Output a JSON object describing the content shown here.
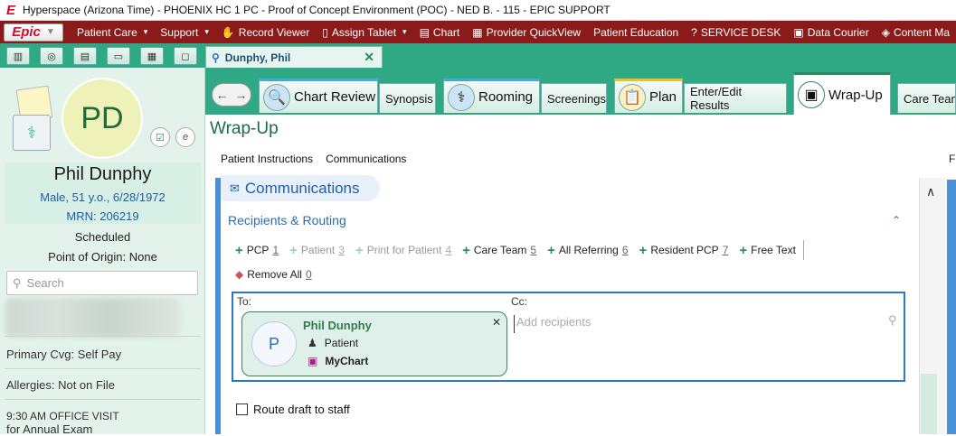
{
  "window": {
    "title": "Hyperspace (Arizona Time) - PHOENIX HC 1 PC - Proof of Concept Environment (POC) - NED B. - 115 - EPIC SUPPORT"
  },
  "menubar": {
    "epic_label": "Epic",
    "items": [
      {
        "label": "Patient Care",
        "icon": "none",
        "dropdown": true
      },
      {
        "label": "Support",
        "icon": "none",
        "dropdown": true
      },
      {
        "label": "Record Viewer",
        "icon": "hand-icon",
        "dropdown": false
      },
      {
        "label": "Assign Tablet",
        "icon": "tablet-icon",
        "dropdown": true
      },
      {
        "label": "Chart",
        "icon": "chart-icon",
        "dropdown": false
      },
      {
        "label": "Provider QuickView",
        "icon": "quickview-icon",
        "dropdown": false
      },
      {
        "label": "Patient Education",
        "icon": "none",
        "dropdown": false
      },
      {
        "label": "SERVICE DESK",
        "icon": "question-icon",
        "dropdown": false
      },
      {
        "label": "Data Courier",
        "icon": "courier-icon",
        "dropdown": false
      },
      {
        "label": "Content Ma",
        "icon": "diamond-icon",
        "dropdown": false
      }
    ]
  },
  "patient_tab": {
    "label": "Dunphy, Phil"
  },
  "sidebar": {
    "initials": "PD",
    "name": "Phil Dunphy",
    "demographics": "Male, 51 y.o., 6/28/1972",
    "mrn": "MRN: 206219",
    "status": "Scheduled",
    "point_of_origin": "Point of Origin: None",
    "search_placeholder": "Search",
    "coverage": "Primary Cvg: Self Pay",
    "allergies": "Allergies: Not on File",
    "visit_line1": "9:30 AM OFFICE VISIT",
    "visit_line2": "for Annual Exam"
  },
  "activity_tabs": [
    {
      "label": "Chart Review",
      "big": true
    },
    {
      "label": "Synopsis",
      "big": false
    },
    {
      "label": "Rooming",
      "big": true
    },
    {
      "label": "Screenings",
      "big": false
    },
    {
      "label": "Plan",
      "big": true
    },
    {
      "label": "Enter/Edit Results",
      "big": false
    },
    {
      "label": "Wrap-Up",
      "big": true,
      "active": true
    },
    {
      "label": "Care Team",
      "big": false
    }
  ],
  "content": {
    "title": "Wrap-Up",
    "subtabs": [
      "Patient Instructions",
      "Communications"
    ],
    "right_cut_letter": "F",
    "section_title": "Communications",
    "subsection_title": "Recipients & Routing",
    "routing_buttons": [
      {
        "label": "PCP",
        "count": "1",
        "enabled": true
      },
      {
        "label": "Patient",
        "count": "3",
        "enabled": false
      },
      {
        "label": "Print for Patient",
        "count": "4",
        "enabled": false
      },
      {
        "label": "Care Team",
        "count": "5",
        "enabled": true
      },
      {
        "label": "All Referring",
        "count": "6",
        "enabled": true
      },
      {
        "label": "Resident PCP",
        "count": "7",
        "enabled": true
      },
      {
        "label": "Free Text",
        "count": "",
        "enabled": true
      }
    ],
    "remove_all": {
      "label": "Remove All",
      "count": "0"
    },
    "to_label": "To:",
    "cc_label": "Cc:",
    "cc_placeholder": "Add recipients",
    "recipient": {
      "initial": "P",
      "name": "Phil Dunphy",
      "role": "Patient",
      "channel": "MyChart"
    },
    "route_draft_label": "Route draft to staff"
  },
  "colors": {
    "menubar": "#8b1a1a",
    "teal": "#2fa884",
    "sidebar_bg": "#e3f3ec",
    "accent_blue": "#2a78c9"
  }
}
